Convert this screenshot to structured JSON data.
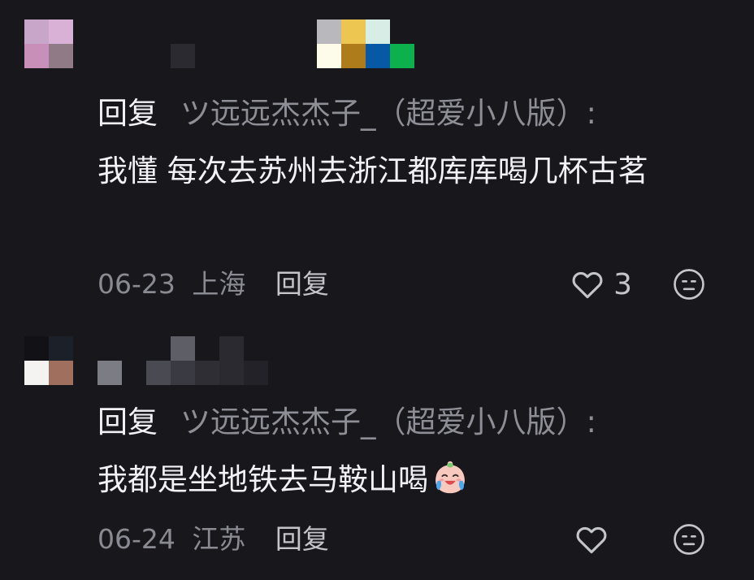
{
  "comments": [
    {
      "avatar_colors": [
        "#c8a6c9",
        "#d9b1d7",
        "#c890b9",
        "#8f7a86"
      ],
      "username_mosaic_colors": [
        "#17171c",
        "#2a2a30",
        "#17171c",
        "#b9b9bd",
        "#edc551",
        "#d7eee7",
        "#fdfbea",
        "#ae7c1a",
        "#0758a5",
        "#0cb04c"
      ],
      "reply_prefix": "回复",
      "reply_target": "ツ远远杰杰子_（超爱小八版）:",
      "text": "我懂 每次去苏州去浙江都库库喝几杯古茗",
      "date": "06-23",
      "location": "上海",
      "reply_label": "回复",
      "like_count": "3"
    },
    {
      "avatar_colors": [
        "#121216",
        "#1c2029",
        "#f4f3f1",
        "#a0705f"
      ],
      "username_mosaic_colors": [
        "#7c7c84",
        "#3a3a42",
        "#5a5a62",
        "#6a6a72",
        "#3a3a42",
        "#4a4a52"
      ],
      "reply_prefix": "回复",
      "reply_target": "ツ远远杰杰子_（超爱小八版）:",
      "text": "我都是坐地铁去马鞍山喝",
      "emoji": "crying-face-emoji",
      "date": "06-24",
      "location": "江苏",
      "reply_label": "回复",
      "like_count": ""
    }
  ]
}
